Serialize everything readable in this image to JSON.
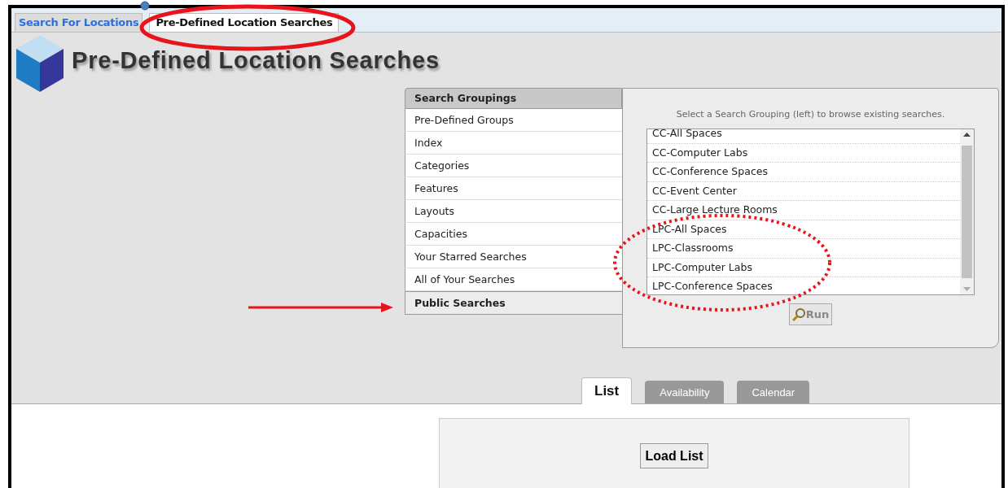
{
  "top_tabs": [
    {
      "label": "Search For Locations",
      "selected": false
    },
    {
      "label": "Pre-Defined Location Searches",
      "selected": true
    }
  ],
  "page_title": "Pre-Defined Location Searches",
  "groupings": {
    "title": "Search Groupings",
    "items": [
      {
        "label": "Pre-Defined Groups",
        "selected": false
      },
      {
        "label": "Index",
        "selected": false
      },
      {
        "label": "Categories",
        "selected": false
      },
      {
        "label": "Features",
        "selected": false
      },
      {
        "label": "Layouts",
        "selected": false
      },
      {
        "label": "Capacities",
        "selected": false
      },
      {
        "label": "Your Starred Searches",
        "selected": false
      },
      {
        "label": "All of Your Searches",
        "selected": false
      },
      {
        "label": "Public Searches",
        "selected": true
      }
    ]
  },
  "searches": {
    "hint": "Select a Search Grouping (left) to browse existing searches.",
    "items": [
      "CC-All Spaces",
      "CC-Computer Labs",
      "CC-Conference Spaces",
      "CC-Event Center",
      "CC-Large Lecture Rooms",
      "LPC-All Spaces",
      "LPC-Classrooms",
      "LPC-Computer Labs",
      "LPC-Conference Spaces"
    ],
    "run_button": "Run"
  },
  "view_tabs": [
    {
      "label": "List",
      "selected": true
    },
    {
      "label": "Availability",
      "selected": false
    },
    {
      "label": "Calendar",
      "selected": false
    }
  ],
  "load_button": "Load List"
}
